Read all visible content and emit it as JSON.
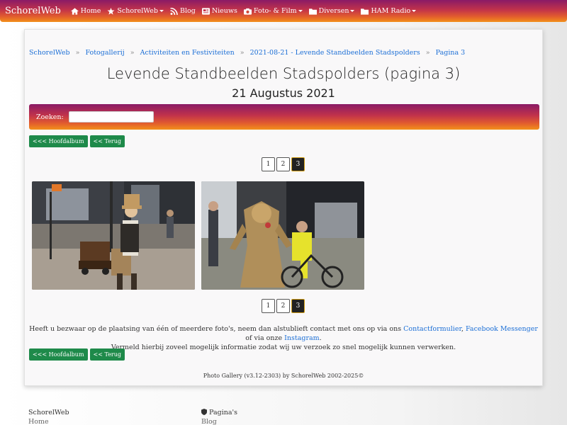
{
  "nav": {
    "brand": "SchorelWeb",
    "items": [
      {
        "label": "Home",
        "icon": "home-icon",
        "dropdown": false
      },
      {
        "label": "SchorelWeb",
        "icon": "star-icon",
        "dropdown": true
      },
      {
        "label": "Blog",
        "icon": "rss-icon",
        "dropdown": false
      },
      {
        "label": "Nieuws",
        "icon": "newspaper-icon",
        "dropdown": false
      },
      {
        "label": "Foto- & Film",
        "icon": "camera-icon",
        "dropdown": true
      },
      {
        "label": "Diversen",
        "icon": "folder-icon",
        "dropdown": true
      },
      {
        "label": "HAM Radio",
        "icon": "folder-icon",
        "dropdown": true
      }
    ]
  },
  "breadcrumb": [
    "SchorelWeb",
    "Fotogallerij",
    "Activiteiten en Festiviteiten",
    "2021-08-21 - Levende Standbeelden Stadspolders",
    "Pagina 3"
  ],
  "breadcrumb_sep": "»",
  "page_title": "Levende Standbeelden Stadspolders (pagina 3)",
  "page_subtitle": "21 Augustus 2021",
  "search": {
    "label": "Zoeken:",
    "value": "",
    "placeholder": ""
  },
  "buttons": {
    "main_album": "<<< Hoofdalbum",
    "back": "<< Terug"
  },
  "pagination": {
    "pages": [
      "1",
      "2",
      "3"
    ],
    "current": "3"
  },
  "photos": [
    {
      "name": "photo-1"
    },
    {
      "name": "photo-2"
    }
  ],
  "notice": {
    "part1": "Heeft u bezwaar op de plaatsing van één of meerdere foto's, neem dan alstublieft contact met ons op via ons ",
    "link1": "Contactformulier",
    "part2": ", ",
    "link2": "Facebook Messenger",
    "part3": " of via onze ",
    "link3": "Instagram",
    "part4": ".",
    "line2": "Vermeld hierbij zoveel mogelijk informatie zodat wij uw verzoek zo snel mogelijk kunnen verwerken."
  },
  "credit": "Photo Gallery (v3.12-2303) by SchorelWeb 2002-2025©",
  "footer": {
    "col1_title": "SchorelWeb",
    "col1_item": "Home",
    "col2_title": "Pagina's",
    "col2_item": "Blog"
  },
  "colors": {
    "accent_top": "#8a1a66",
    "accent_bottom": "#f2901a",
    "button_green": "#1e8a4a",
    "link": "#1c6fd6"
  }
}
